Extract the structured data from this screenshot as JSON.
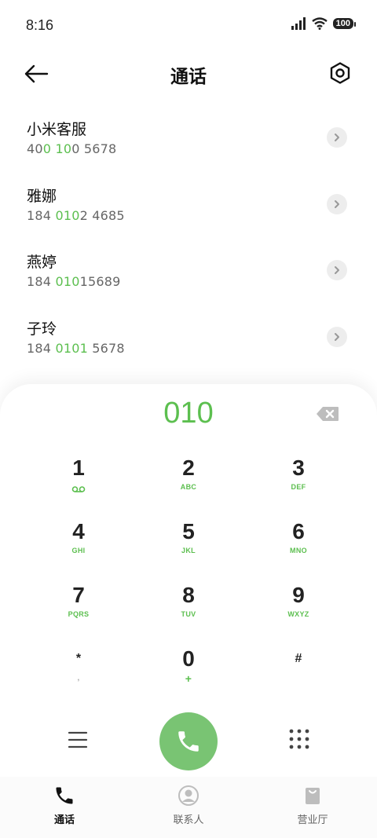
{
  "status": {
    "time": "8:16",
    "battery": "100"
  },
  "header": {
    "title": "通话"
  },
  "contacts": [
    {
      "name": "小米客服",
      "number_parts": [
        "40",
        "0",
        " ",
        "10",
        "0 5678"
      ]
    },
    {
      "name": "雅娜",
      "number_parts": [
        "184 ",
        "010",
        "2 4685"
      ]
    },
    {
      "name": "燕婷",
      "number_parts": [
        "184 ",
        "010",
        "15689"
      ]
    },
    {
      "name": "子玲",
      "number_parts": [
        "184 ",
        "0101",
        " 5678"
      ]
    }
  ],
  "dialpad": {
    "input": "010",
    "keys": [
      {
        "digit": "1",
        "letters": ""
      },
      {
        "digit": "2",
        "letters": "ABC"
      },
      {
        "digit": "3",
        "letters": "DEF"
      },
      {
        "digit": "4",
        "letters": "GHI"
      },
      {
        "digit": "5",
        "letters": "JKL"
      },
      {
        "digit": "6",
        "letters": "MNO"
      },
      {
        "digit": "7",
        "letters": "PQRS"
      },
      {
        "digit": "8",
        "letters": "TUV"
      },
      {
        "digit": "9",
        "letters": "WXYZ"
      },
      {
        "digit": "*",
        "letters": ","
      },
      {
        "digit": "0",
        "letters": "+"
      },
      {
        "digit": "#",
        "letters": ""
      }
    ]
  },
  "tabs": [
    {
      "label": "通话",
      "icon": "phone-icon",
      "active": true
    },
    {
      "label": "联系人",
      "icon": "contacts-icon",
      "active": false
    },
    {
      "label": "营业厅",
      "icon": "store-bag-icon",
      "active": false
    }
  ],
  "colors": {
    "accent": "#5cbf4f",
    "call_button": "#79c473"
  }
}
